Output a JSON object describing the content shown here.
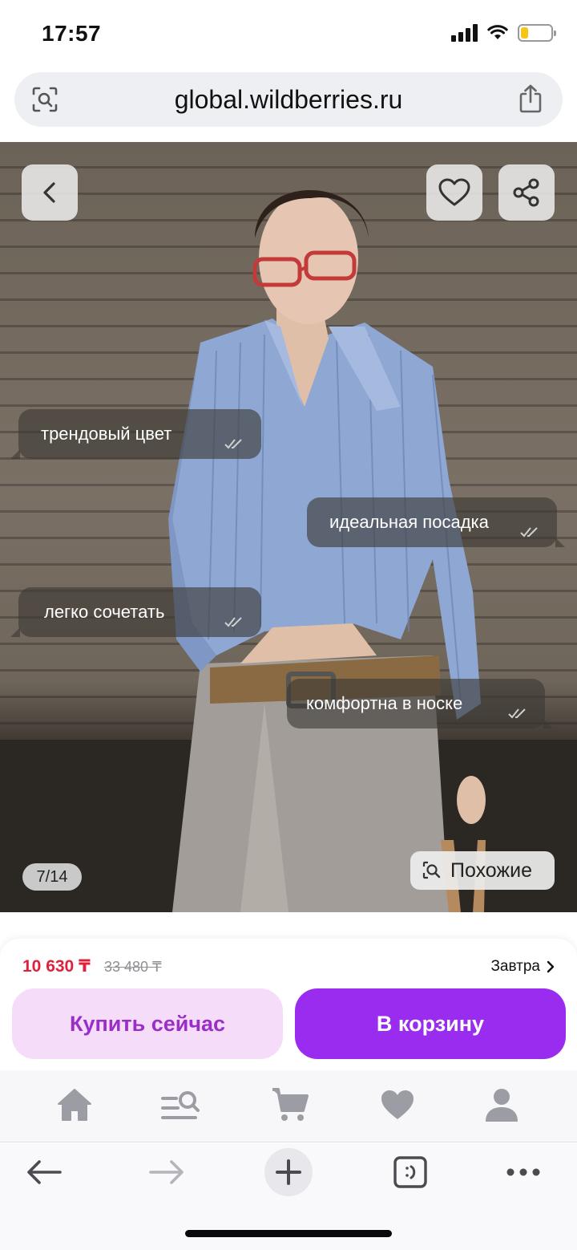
{
  "status_bar": {
    "time": "17:57",
    "battery_level": 0.25,
    "battery_color": "#f5c518"
  },
  "browser": {
    "url": "global.wildberries.ru"
  },
  "hero": {
    "bubbles": [
      "трендовый цвет",
      "идеальная посадка",
      "легко сочетать",
      "комфортна в носке"
    ],
    "counter": "7/14",
    "similar_label": "Похожие",
    "icons": {
      "back": "chevron-left-icon",
      "favorite": "heart-outline-icon",
      "share": "share-icon"
    }
  },
  "product": {
    "price": "10 630 ₸",
    "old_price": "33 480 ₸",
    "delivery": "Завтра",
    "buy_now_label": "Купить сейчас",
    "add_to_cart_label": "В корзину",
    "colors": {
      "price": "#e0213d",
      "accent": "#9a2cf0",
      "buy_now_bg": "#f5dcf9"
    }
  },
  "tab_bar": [
    "home-icon",
    "catalog-search-icon",
    "cart-icon",
    "favorites-icon",
    "profile-icon"
  ],
  "browser_toolbar": [
    "back-arrow-icon",
    "forward-arrow-icon",
    "new-tab-plus-icon",
    "tabs-icon",
    "more-icon"
  ]
}
